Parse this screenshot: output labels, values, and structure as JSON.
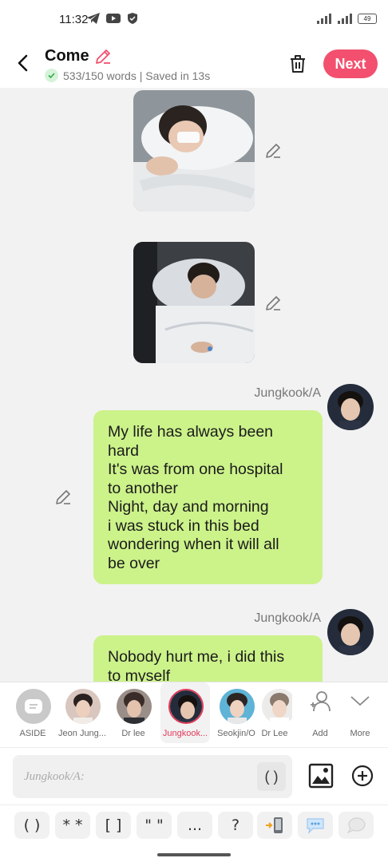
{
  "status_bar": {
    "time": "11:32",
    "battery": "49"
  },
  "header": {
    "title": "Come",
    "subtitle": "533/150 words | Saved in 13s",
    "next_label": "Next"
  },
  "messages": [
    {
      "speaker": "Jungkook/A",
      "text": "My life has always been\nhard\nIt's was from one hospital\nto another\nNight, day and morning\ni was stuck in this bed\nwondering when it will all\nbe over"
    },
    {
      "speaker": "Jungkook/A",
      "text": "Nobody hurt me, i did this\nto myself"
    }
  ],
  "characters": [
    {
      "label": "ASIDE"
    },
    {
      "label": "Jeon Jung..."
    },
    {
      "label": "Dr lee"
    },
    {
      "label": "Jungkook..."
    },
    {
      "label": "Seokjin/O"
    },
    {
      "label": "Dr Lee"
    },
    {
      "label": "Add"
    },
    {
      "label": "More"
    }
  ],
  "input": {
    "placeholder": "Jungkook/A:",
    "paren_label": "( )"
  },
  "tools": [
    {
      "label": "( )"
    },
    {
      "label": "* *"
    },
    {
      "label": "[ ]"
    },
    {
      "label": "\" \""
    },
    {
      "label": "..."
    },
    {
      "label": "?"
    }
  ],
  "colors": {
    "accent": "#f2506e",
    "bubble": "#ccf28a",
    "selected": "#e23b5a"
  }
}
